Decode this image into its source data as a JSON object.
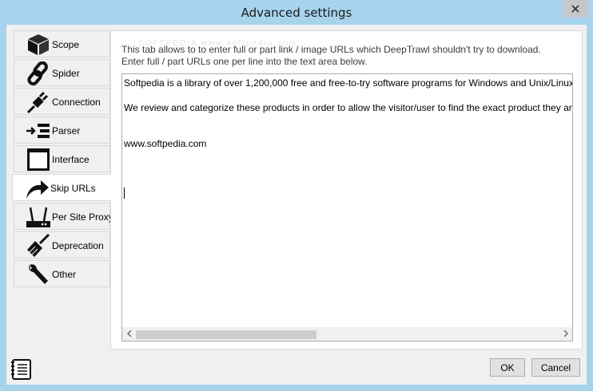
{
  "window": {
    "title": "Advanced settings",
    "close_icon": "close-icon"
  },
  "tabs": [
    {
      "id": "scope",
      "label": "Scope",
      "icon": "cube-icon",
      "active": false
    },
    {
      "id": "spider",
      "label": "Spider",
      "icon": "chain-link-icon",
      "active": false
    },
    {
      "id": "connection",
      "label": "Connection",
      "icon": "plug-icon",
      "active": false
    },
    {
      "id": "parser",
      "label": "Parser",
      "icon": "parser-arrow-icon",
      "active": false
    },
    {
      "id": "interface",
      "label": "Interface",
      "icon": "window-icon",
      "active": false
    },
    {
      "id": "skip-urls",
      "label": "Skip URLs",
      "icon": "curved-arrow-icon",
      "active": true
    },
    {
      "id": "per-site-proxy",
      "label": "Per Site Proxy",
      "icon": "router-icon",
      "active": false
    },
    {
      "id": "deprecation",
      "label": "Deprecation",
      "icon": "broom-icon",
      "active": false
    },
    {
      "id": "other",
      "label": "Other",
      "icon": "wrench-icon",
      "active": false
    }
  ],
  "panel": {
    "intro_line1": "This tab allows to to enter full or part link / image URLs which DeepTrawl shouldn't try to download.",
    "intro_line2": "Enter full / part URLs one per line into the text area below.",
    "watermark": "SOFTPEDIA www.softpedia.com",
    "textarea_value": "Softpedia is a library of over 1,200,000 free and free-to-try software programs for Windows and Unix/Linux, games,\n\nWe review and categorize these products in order to allow the visitor/user to find the exact product they and their s\n\n\nwww.softpedia.com"
  },
  "footer": {
    "notes_icon": "notes-icon",
    "ok_label": "OK",
    "cancel_label": "Cancel"
  },
  "colors": {
    "title_bar": "#a7d3ec",
    "client_bg": "#f0f0f0",
    "close_button": "#c7c7c7"
  }
}
